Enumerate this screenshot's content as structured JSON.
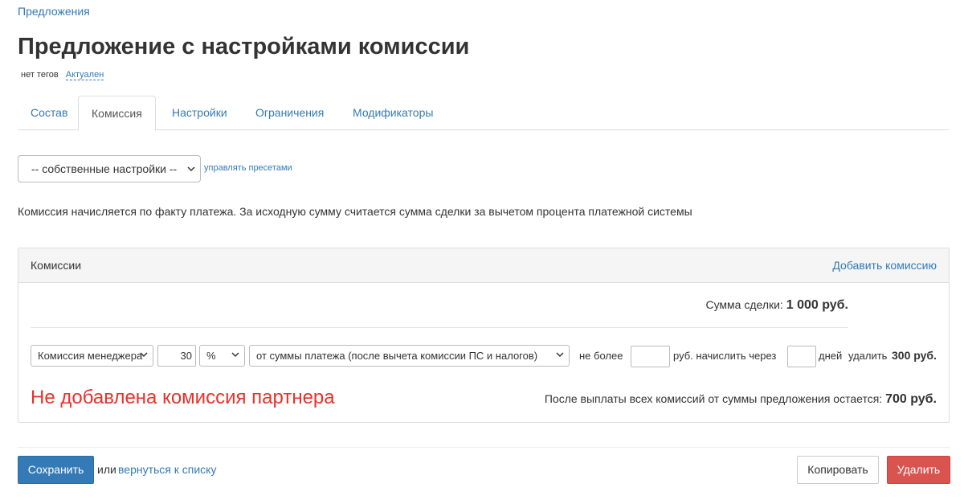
{
  "breadcrumb": {
    "label": "Предложения"
  },
  "page": {
    "title": "Предложение с настройками комиссии"
  },
  "meta": {
    "tags": "нет тегов",
    "status": "Актуален"
  },
  "tabs": [
    {
      "label": "Состав",
      "active": false
    },
    {
      "label": "Комиссия",
      "active": true
    },
    {
      "label": "Настройки",
      "active": false
    },
    {
      "label": "Ограничения",
      "active": false
    },
    {
      "label": "Модификаторы",
      "active": false
    }
  ],
  "preset": {
    "selected": "-- собственные настройки --",
    "manage_label": "управлять пресетами"
  },
  "description": "Комиссия начисляется по факту платежа. За исходную сумму считается сумма сделки за вычетом процента платежной системы",
  "panel": {
    "title": "Комиссии",
    "add_label": "Добавить комиссию",
    "deal_sum_label": "Сумма сделки:",
    "deal_sum_value": "1 000 руб.",
    "row": {
      "type_selected": "Комиссия менеджера",
      "value": "30",
      "unit_selected": "%",
      "base_selected": "от суммы платежа (после вычета комиссии ПС и налогов)",
      "max_label": "не более",
      "max_value": "",
      "currency_label": "руб. начислить через",
      "days_value": "",
      "days_label": "дней",
      "delete_label": "удалить",
      "amount": "300 руб."
    },
    "warning": "Не добавлена комиссия партнера",
    "remaining_label": "После выплаты всех комиссий от суммы предложения остается:",
    "remaining_value": "700 руб."
  },
  "footer": {
    "save_label": "Сохранить",
    "or_label": "или",
    "back_label": "вернуться к списку",
    "copy_label": "Копировать",
    "delete_label": "Удалить"
  },
  "colors": {
    "accent": "#337ab7",
    "danger": "#d9534f",
    "warning_text": "#e8322b"
  }
}
